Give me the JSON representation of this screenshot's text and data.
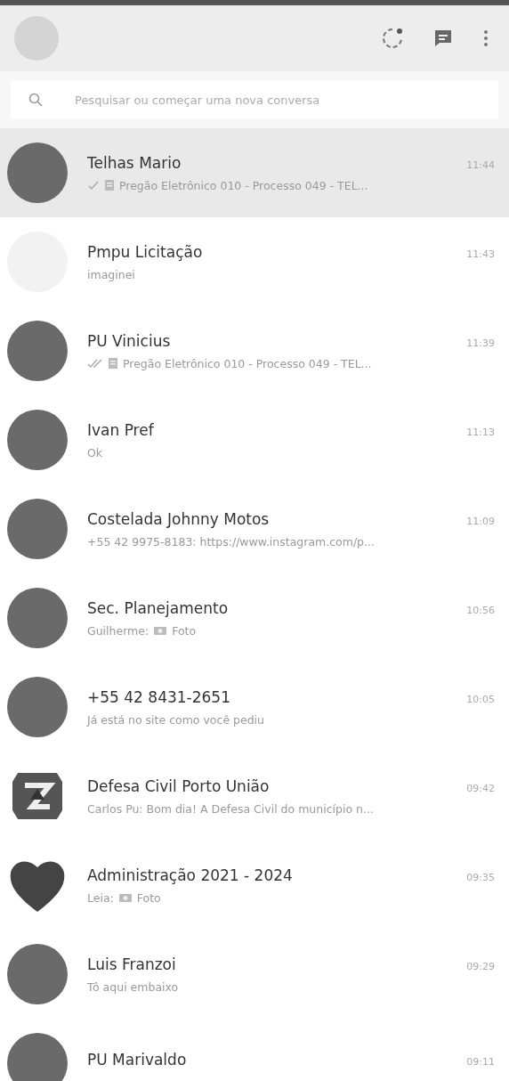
{
  "header": {
    "actions": [
      {
        "kind": "status"
      },
      {
        "kind": "chat"
      },
      {
        "kind": "menu"
      }
    ]
  },
  "search": {
    "placeholder": "Pesquisar ou começar uma nova conversa"
  },
  "chats": [
    {
      "name": "Telhas Mario",
      "time": "11:44",
      "avatar": {
        "kind": "photo"
      },
      "receipt": {
        "kind": "single"
      },
      "media": {
        "kind": "document"
      },
      "preview": "Pregão Eletrônico 010 - Processo 049 - TEL...",
      "selected": true
    },
    {
      "name": "Pmpu Licitação",
      "time": "11:43",
      "avatar": {
        "kind": "blank"
      },
      "preview": "imaginei",
      "selected": false
    },
    {
      "name": "PU Vinicius",
      "time": "11:39",
      "avatar": {
        "kind": "photo"
      },
      "receipt": {
        "kind": "double"
      },
      "media": {
        "kind": "document"
      },
      "preview": "Pregão Eletrônico 010 - Processo 049 - TEL...",
      "selected": false
    },
    {
      "name": "Ivan Pref",
      "time": "11:13",
      "avatar": {
        "kind": "photo"
      },
      "preview": "Ok",
      "selected": false
    },
    {
      "name": "Costelada Johnny Motos",
      "time": "11:09",
      "avatar": {
        "kind": "photo"
      },
      "preview": "+55 42 9975-8183: https://www.instagram.com/p...",
      "selected": false
    },
    {
      "name": "Sec. Planejamento",
      "time": "10:56",
      "avatar": {
        "kind": "photo"
      },
      "sender": "Guilherme:",
      "media": {
        "kind": "photo"
      },
      "preview": "Foto",
      "selected": false
    },
    {
      "name": "+55 42 8431-2651",
      "time": "10:05",
      "avatar": {
        "kind": "photo"
      },
      "preview": "Já está no site como você pediu",
      "selected": false
    },
    {
      "name": "Defesa Civil Porto União",
      "time": "09:42",
      "avatar": {
        "kind": "logo"
      },
      "preview": "Carlos Pu: Bom dia! A Defesa Civil do município n...",
      "selected": false
    },
    {
      "name": "Administração 2021 - 2024",
      "time": "09:35",
      "avatar": {
        "kind": "heart"
      },
      "sender": "Leia:",
      "media": {
        "kind": "photo"
      },
      "preview": "Foto",
      "selected": false
    },
    {
      "name": "Luis Franzoi",
      "time": "09:29",
      "avatar": {
        "kind": "photo"
      },
      "preview": "Tô aqui embaixo",
      "selected": false
    },
    {
      "name": "PU Marivaldo",
      "time": "09:11",
      "avatar": {
        "kind": "photo"
      },
      "selected": false
    }
  ]
}
